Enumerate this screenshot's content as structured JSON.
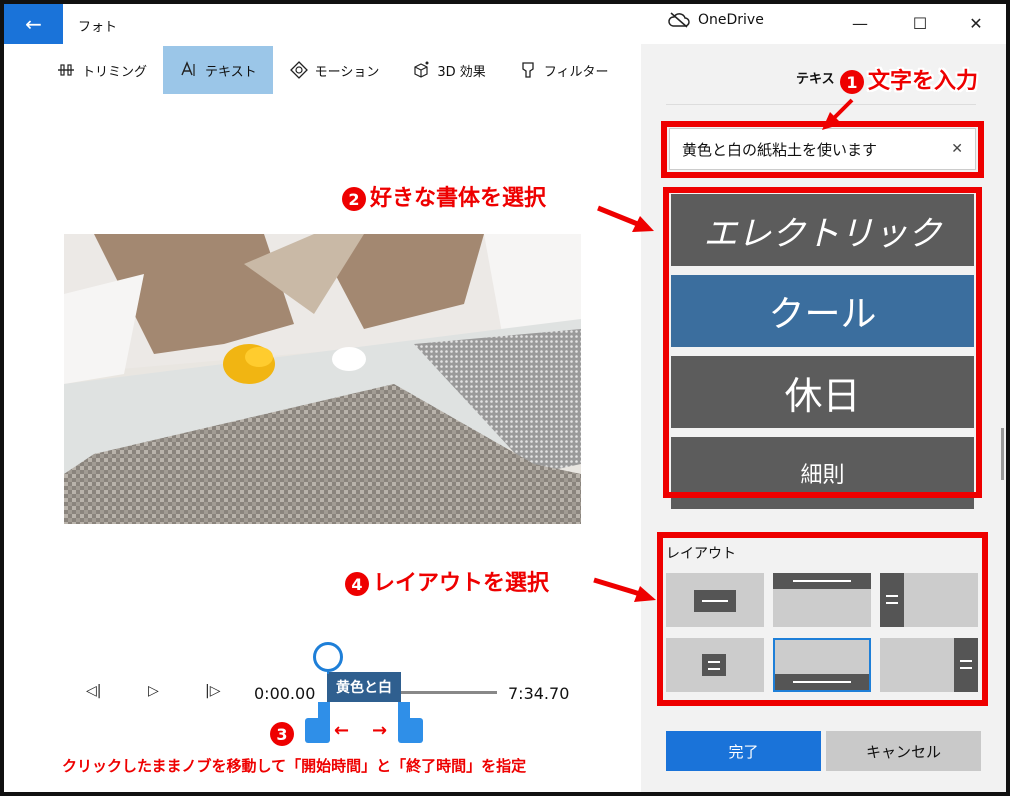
{
  "window": {
    "app_title": "フォト",
    "back_icon": "←",
    "onedrive_label": "OneDrive",
    "minimize": "—",
    "maximize": "☐",
    "close": "✕"
  },
  "toolbar": {
    "items": [
      {
        "label": "トリミング",
        "icon": "trim-icon"
      },
      {
        "label": "テキスト",
        "icon": "text-icon"
      },
      {
        "label": "モーション",
        "icon": "motion-icon"
      },
      {
        "label": "3D 効果",
        "icon": "3d-effect-icon"
      },
      {
        "label": "フィルター",
        "icon": "filter-icon"
      }
    ],
    "active_index": 1
  },
  "timeline": {
    "start_time": "0:00.00",
    "end_time": "7:34.70",
    "clip_label": "黄色と白",
    "prev_icon": "◁|",
    "play_icon": "▷",
    "next_icon": "|▷"
  },
  "panel": {
    "title": "テキス",
    "text_value": "黄色と白の紙粘土を使います",
    "clear_icon": "✕",
    "fonts": [
      {
        "label": "エレクトリック"
      },
      {
        "label": "クール"
      },
      {
        "label": "休日"
      },
      {
        "label": "細則"
      }
    ],
    "selected_font_index": 1,
    "layout_label": "レイアウト",
    "selected_layout_index": 4,
    "done_label": "完了",
    "cancel_label": "キャンセル"
  },
  "annotations": {
    "step1_num": "1",
    "step1": "文字を入力",
    "step2_num": "2",
    "step2": "好きな書体を選択",
    "step3_num": "3",
    "step3": "クリックしたままノブを移動して「開始時間」と「終了時間」を指定",
    "step4_num": "4",
    "step4": "レイアウトを選択",
    "arrow_left": "←",
    "arrow_right": "→"
  },
  "colors": {
    "accent": "#1a73d9",
    "selected_font": "#3b6e9e",
    "annotation_red": "#ee0000",
    "toolbar_active": "#9bc6e8"
  }
}
